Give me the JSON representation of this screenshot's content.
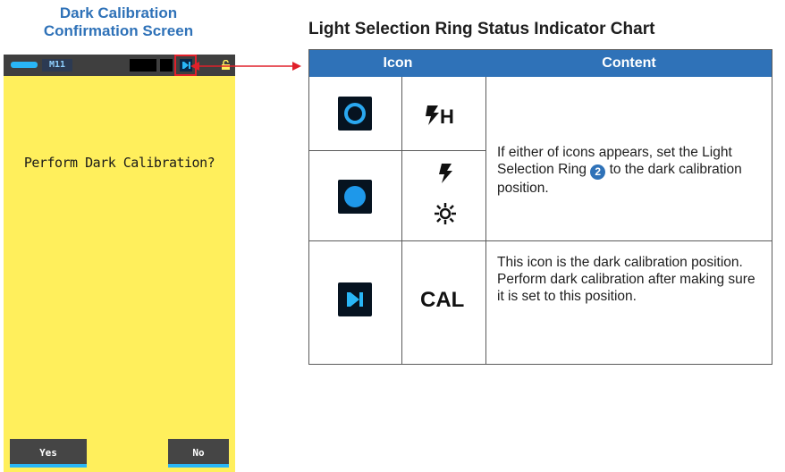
{
  "left_title": {
    "line1": "Dark Calibration",
    "line2": "Confirmation Screen"
  },
  "device": {
    "mode_label": "M11",
    "prompt": "Perform Dark Calibration?",
    "yes_label": "Yes",
    "no_label": "No"
  },
  "chart_title": "Light Selection Ring Status Indicator Chart",
  "table": {
    "header_icon": "Icon",
    "header_content": "Content",
    "row_group1": {
      "icons": [
        "dark-circle-outline-icon",
        "flash-h-icon",
        "filled-blue-circle-icon",
        "flash-icon",
        "sun-icon"
      ],
      "flash_h_letter": "H",
      "content_before": "If either of icons appears, set the Light Selection Ring",
      "badge": "2",
      "content_after": "to the dark calibration position."
    },
    "row_cal": {
      "icons": [
        "cal-position-icon"
      ],
      "label": "CAL",
      "content_line1": "This icon is the dark calibration position.",
      "content_line2": "Perform dark calibration after making sure it is set to this position."
    }
  },
  "colors": {
    "accent_blue": "#2f72b8",
    "screen_yellow": "#ffef5c",
    "highlight_red": "#e0202a",
    "cyan": "#29b6f6"
  }
}
